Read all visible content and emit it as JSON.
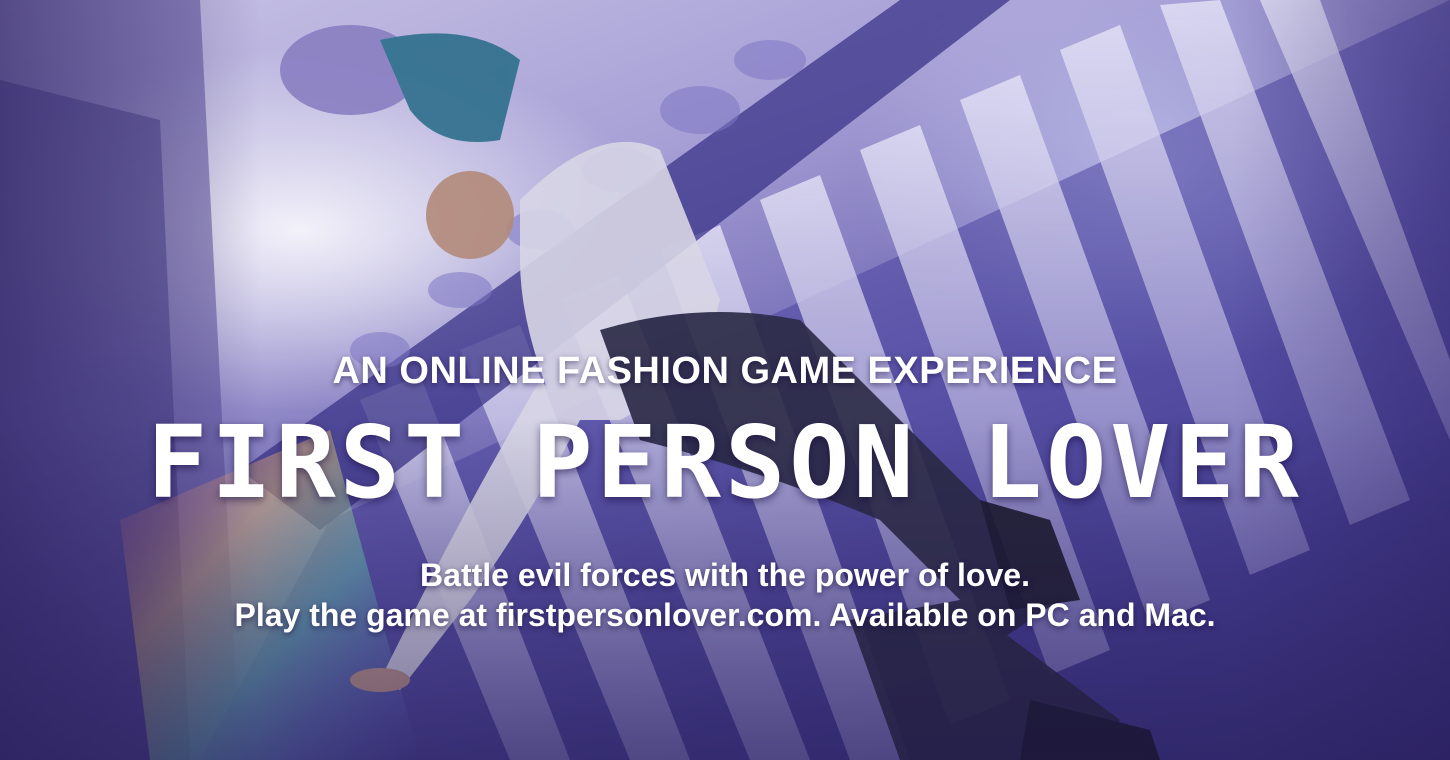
{
  "ad": {
    "kicker": "AN ONLINE FASHION GAME EXPERIENCE",
    "title": "FIRST PERSON LOVER",
    "tagline_line1": "Battle evil forces with the power of love.",
    "tagline_line2": "Play the game at firstpersonlover.com. Available on PC and Mac."
  },
  "colors": {
    "text": "#ffffff",
    "sky": "#c9c4e6",
    "building": "#6a63b0",
    "shadow": "#2a2466"
  }
}
